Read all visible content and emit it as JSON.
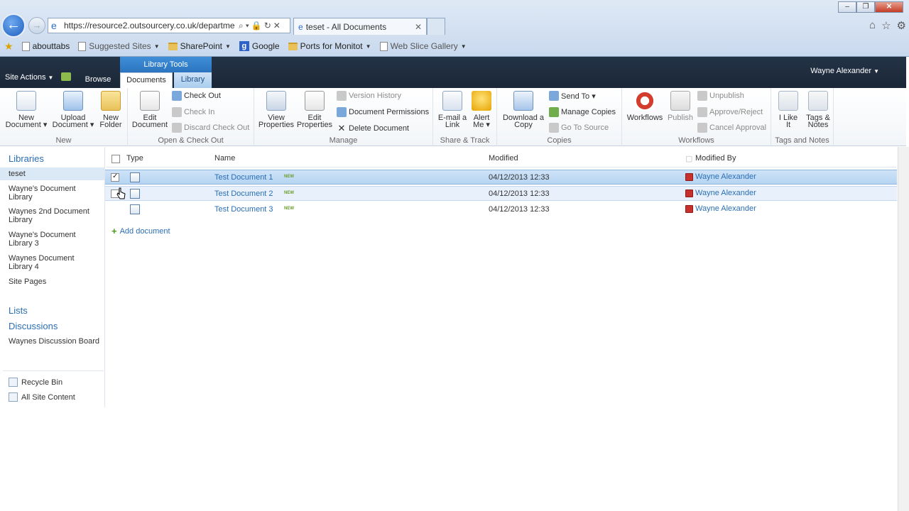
{
  "browser": {
    "url": "https://resource2.outsourcery.co.uk/departmen",
    "tab_title": "teset - All Documents",
    "favorites": [
      {
        "label": "abouttabs",
        "icon": "page-icon"
      },
      {
        "label": "Suggested Sites",
        "icon": "page-icon"
      },
      {
        "label": "SharePoint",
        "icon": "folder-icon"
      },
      {
        "label": "Google",
        "icon": "google-icon"
      },
      {
        "label": "Ports for Monitot",
        "icon": "folder-icon"
      },
      {
        "label": "Web Slice Gallery",
        "icon": "page-icon"
      }
    ]
  },
  "sharepoint": {
    "site_actions": "Site Actions",
    "context_group": "Library Tools",
    "tabs": {
      "browse": "Browse",
      "documents": "Documents",
      "library": "Library"
    },
    "user": "Wayne Alexander"
  },
  "ribbon": {
    "new": {
      "label": "New",
      "new_document": "New\nDocument ▾",
      "upload_document": "Upload\nDocument ▾",
      "new_folder": "New\nFolder"
    },
    "open_checkout": {
      "label": "Open & Check Out",
      "edit_document": "Edit\nDocument",
      "check_out": "Check Out",
      "check_in": "Check In",
      "discard_check_out": "Discard Check Out"
    },
    "manage": {
      "label": "Manage",
      "view_properties": "View\nProperties",
      "edit_properties": "Edit\nProperties",
      "version_history": "Version History",
      "document_permissions": "Document Permissions",
      "delete_document": "Delete Document"
    },
    "share_track": {
      "label": "Share & Track",
      "email_link": "E-mail a\nLink",
      "alert_me": "Alert\nMe ▾"
    },
    "copies": {
      "label": "Copies",
      "download_copy": "Download a\nCopy",
      "send_to": "Send To ▾",
      "manage_copies": "Manage Copies",
      "go_to_source": "Go To Source"
    },
    "workflows": {
      "label": "Workflows",
      "workflows": "Workflows",
      "publish": "Publish",
      "unpublish": "Unpublish",
      "approve_reject": "Approve/Reject",
      "cancel_approval": "Cancel Approval"
    },
    "tags_notes": {
      "label": "Tags and Notes",
      "i_like_it": "I Like\nIt",
      "tags_notes": "Tags &\nNotes"
    }
  },
  "leftnav": {
    "libraries_heading": "Libraries",
    "libraries": [
      "teset",
      "Wayne's Document Library",
      "Waynes 2nd Document Library",
      "Wayne's Document Library 3",
      "Waynes Document Library 4",
      "Site Pages"
    ],
    "lists_heading": "Lists",
    "discussions_heading": "Discussions",
    "discussions": [
      "Waynes Discussion Board"
    ],
    "recycle_bin": "Recycle Bin",
    "all_site_content": "All Site Content"
  },
  "list": {
    "columns": {
      "type": "Type",
      "name": "Name",
      "modified": "Modified",
      "modified_by": "Modified By"
    },
    "new_badge": "NEW",
    "rows": [
      {
        "name": "Test Document 1",
        "modified": "04/12/2013 12:33",
        "modified_by": "Wayne Alexander",
        "selected": true
      },
      {
        "name": "Test Document 2",
        "modified": "04/12/2013 12:33",
        "modified_by": "Wayne Alexander",
        "selected": false
      },
      {
        "name": "Test Document 3",
        "modified": "04/12/2013 12:33",
        "modified_by": "Wayne Alexander",
        "selected": false
      }
    ],
    "add_document": "Add document"
  }
}
